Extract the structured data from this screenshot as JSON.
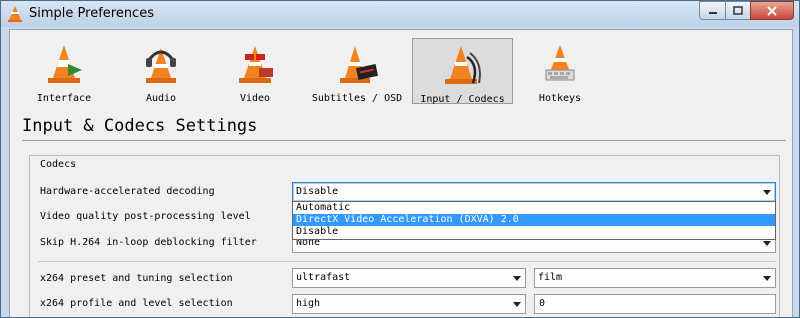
{
  "window": {
    "title": "Simple Preferences"
  },
  "tabs": [
    {
      "label": "Interface",
      "icon": "traffic-cone-interface-icon"
    },
    {
      "label": "Audio",
      "icon": "traffic-cone-headphones-icon"
    },
    {
      "label": "Video",
      "icon": "traffic-cone-glasses-icon"
    },
    {
      "label": "Subtitles / OSD",
      "icon": "traffic-cone-subtitles-icon"
    },
    {
      "label": "Input / Codecs",
      "icon": "traffic-cone-cables-icon",
      "selected": true
    },
    {
      "label": "Hotkeys",
      "icon": "traffic-cone-keyboard-icon"
    }
  ],
  "section": {
    "title": "Input & Codecs Settings"
  },
  "codecs": {
    "group_title": "Codecs",
    "hw_decoding": {
      "label": "Hardware-accelerated decoding",
      "value": "Disable"
    },
    "dropdown_options": [
      "Automatic",
      "DirectX Video Acceleration (DXVA) 2.0",
      "Disable"
    ],
    "dropdown_highlighted": "DirectX Video Acceleration (DXVA) 2.0",
    "post_processing": {
      "label": "Video quality post-processing level"
    },
    "skip_h264": {
      "label": "Skip H.264 in-loop deblocking filter",
      "value": "None"
    },
    "x264_preset": {
      "label": "x264 preset and tuning selection",
      "preset": "ultrafast",
      "tune": "film"
    },
    "x264_profile": {
      "label": "x264 profile and level selection",
      "profile": "high",
      "level": "0"
    }
  },
  "colors": {
    "accent": "#3399ff",
    "focus_border": "#3c7fb1",
    "close_button": "#c9453a"
  }
}
